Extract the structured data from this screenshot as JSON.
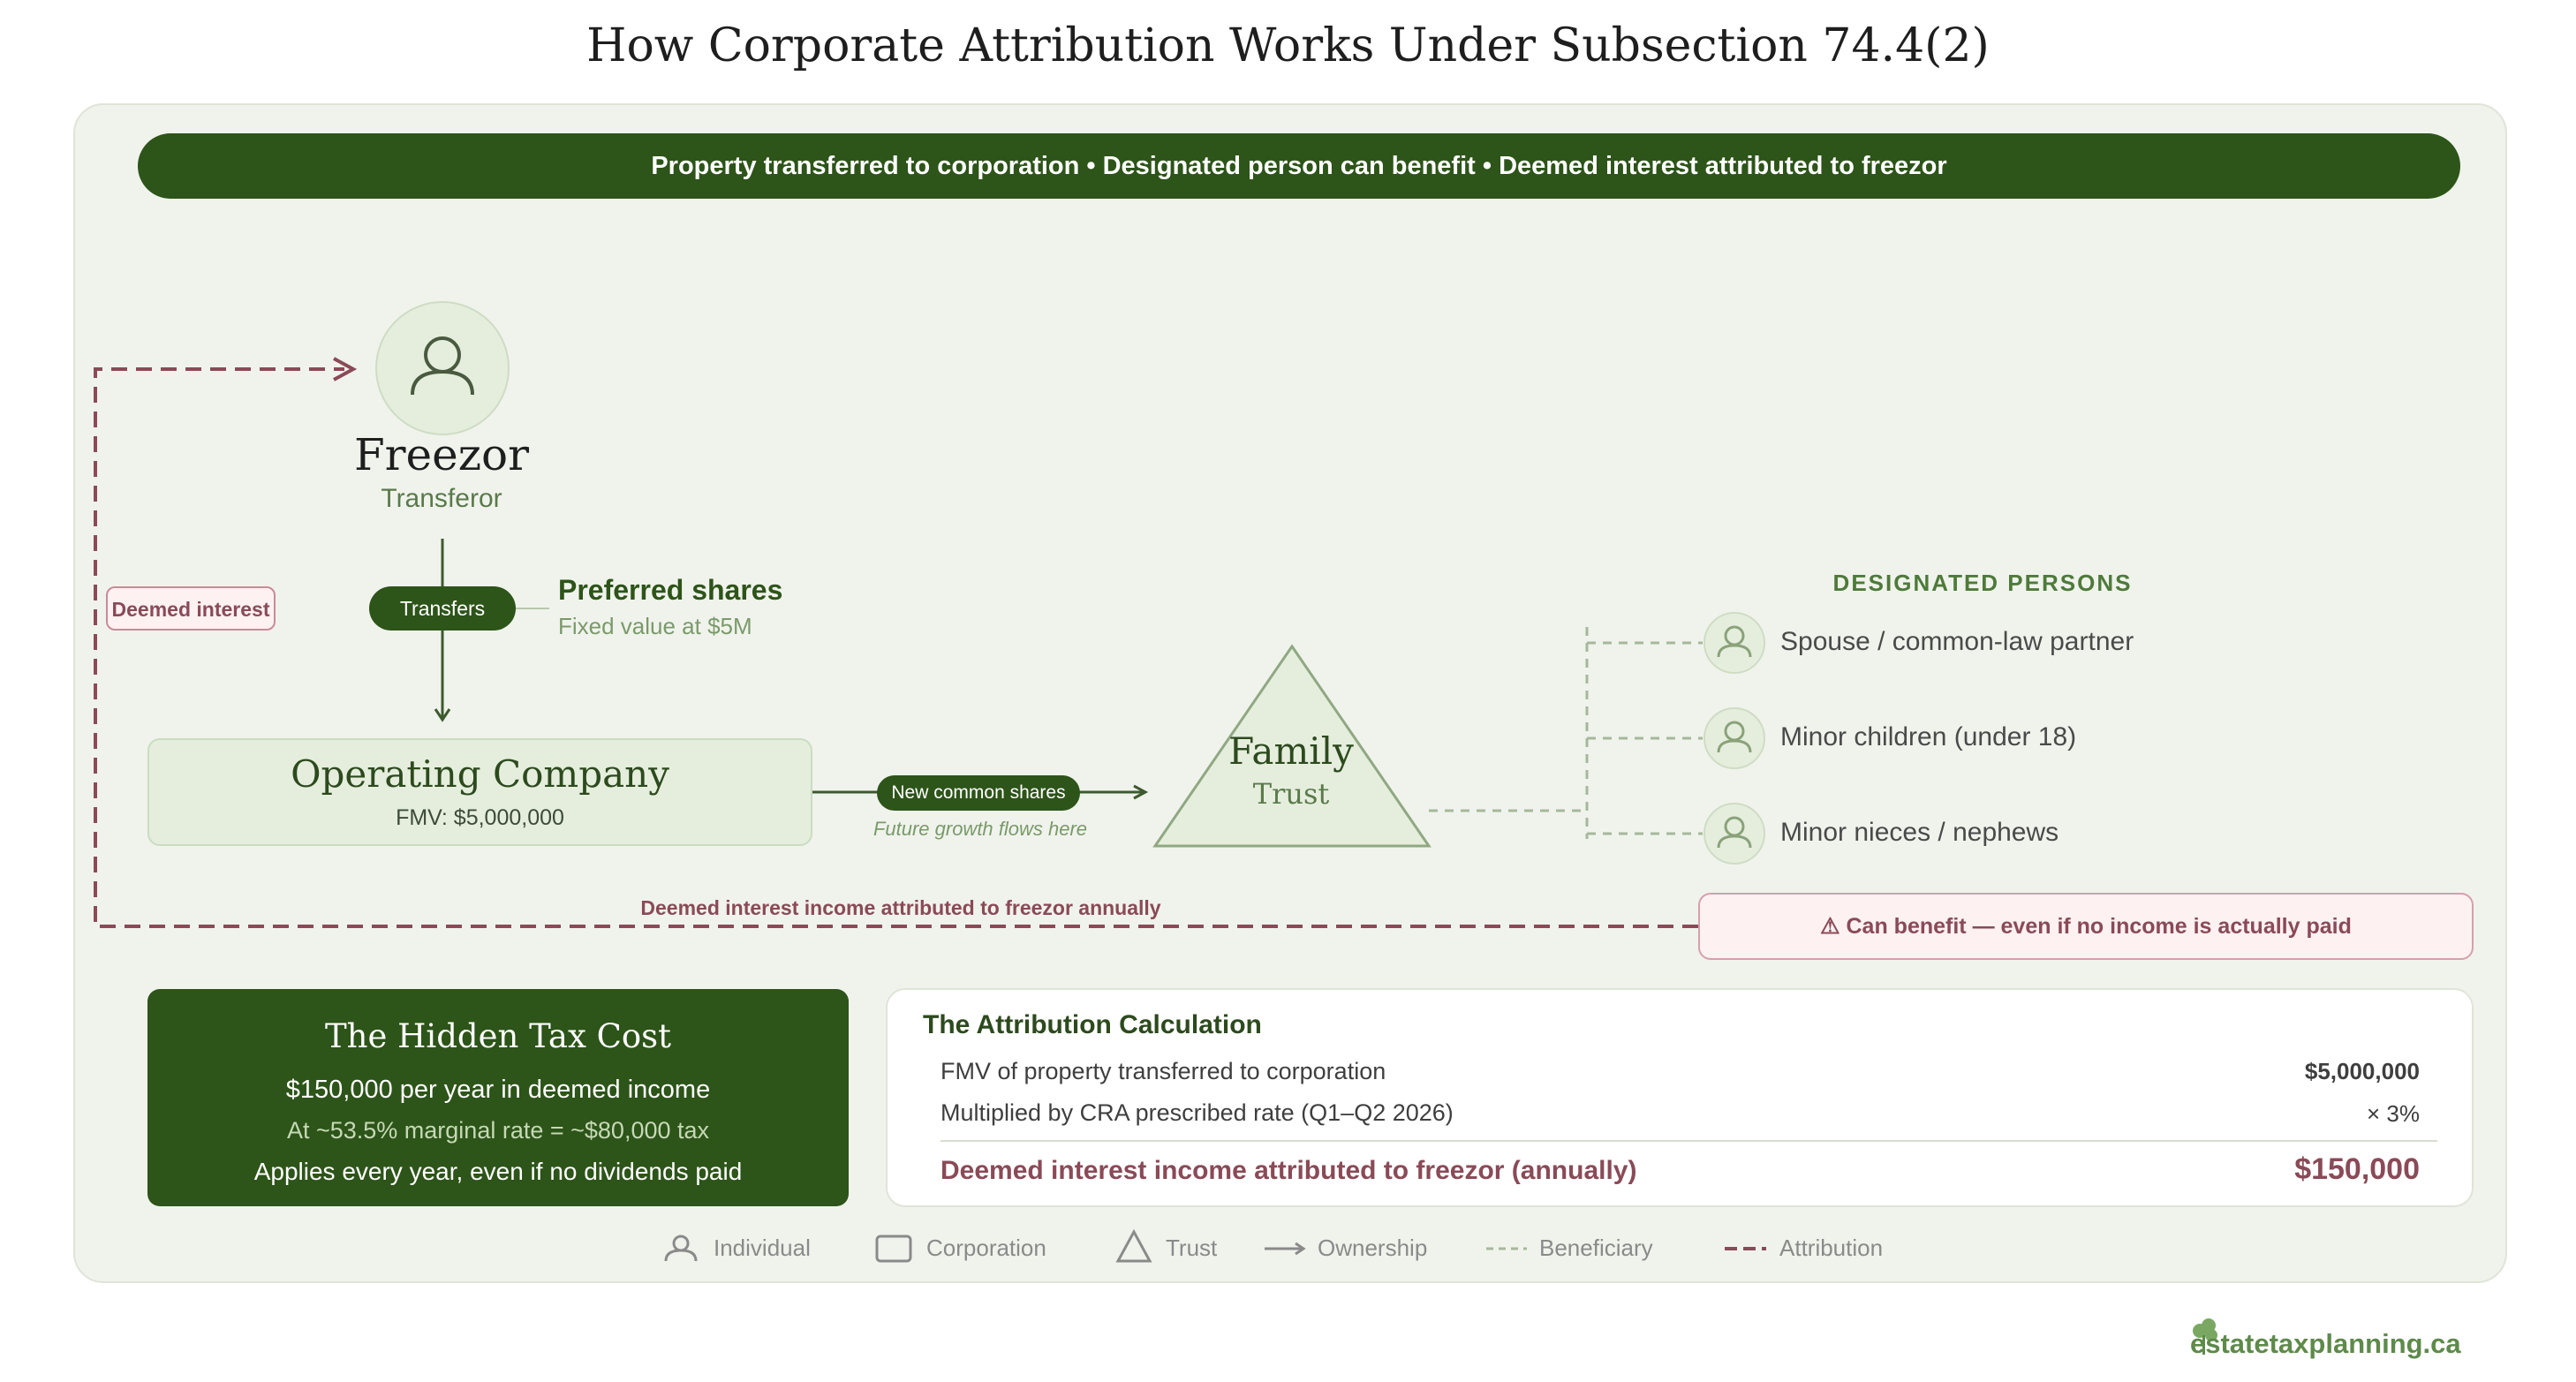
{
  "title": "How Corporate Attribution Works Under Subsection 74.4(2)",
  "banner": "Property transferred to corporation • Designated person can benefit • Deemed interest attributed to freezor",
  "freezor": {
    "name": "Freezor",
    "role": "Transferor"
  },
  "transfer": {
    "pill": "Transfers",
    "shares_title": "Preferred shares",
    "shares_note": "Fixed value at $5M"
  },
  "deemed_interest_badge": "Deemed interest",
  "operating_company": {
    "name": "Operating Company",
    "fmv": "FMV: $5,000,000"
  },
  "common_shares": {
    "pill": "New common shares",
    "note": "Future growth flows here"
  },
  "trust": {
    "name": "Family",
    "sub": "Trust"
  },
  "designated_persons": {
    "heading": "DESIGNATED PERSONS",
    "items": [
      {
        "label": "Spouse / common-law partner",
        "icon": "person-icon"
      },
      {
        "label": "Minor children (under 18)",
        "icon": "person-icon"
      },
      {
        "label": "Minor nieces / nephews",
        "icon": "person-icon"
      }
    ]
  },
  "attribution_line_label": "Deemed interest income attributed to freezor annually",
  "warning": "⚠ Can benefit — even if no income is actually paid",
  "hidden_tax": {
    "title": "The Hidden Tax Cost",
    "line1": "$150,000 per year in deemed income",
    "line2": "At ~53.5% marginal rate = ~$80,000 tax",
    "line3": "Applies every year, even if no dividends paid"
  },
  "calculation": {
    "title": "The Attribution Calculation",
    "rows": [
      {
        "label": "FMV of property transferred to corporation",
        "value": "$5,000,000"
      },
      {
        "label": "Multiplied by CRA prescribed rate (Q1–Q2 2026)",
        "value": "× 3%"
      }
    ],
    "total": {
      "label": "Deemed interest income attributed to freezor (annually)",
      "value": "$150,000"
    }
  },
  "legend": [
    "Individual",
    "Corporation",
    "Trust",
    "Ownership",
    "Beneficiary",
    "Attribution"
  ],
  "brand": "estatetaxplanning.ca",
  "colors": {
    "primary_green": "#2d5419",
    "attribution_red": "#8a4a57",
    "panel_bg": "#f0f3ec"
  }
}
